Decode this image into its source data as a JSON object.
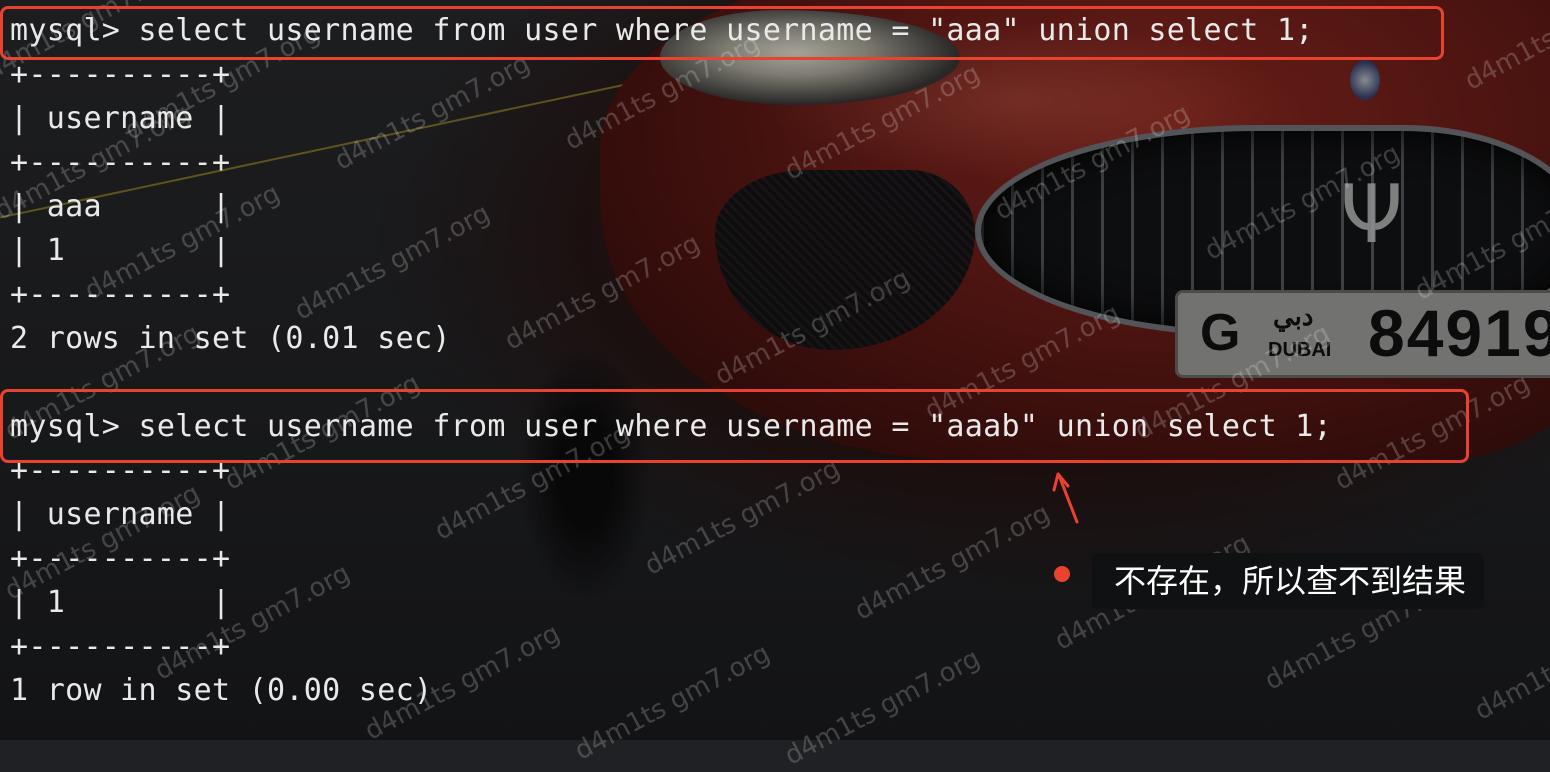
{
  "terminal": {
    "query1": {
      "command": "mysql> select username from user where username = \"aaa\" union select 1;",
      "table_border": "+----------+",
      "header": "| username |",
      "rows": [
        "| aaa      |",
        "| 1        |"
      ],
      "summary": "2 rows in set (0.01 sec)"
    },
    "query2": {
      "command": "mysql> select username from user where username = \"aaab\" union select 1;",
      "table_border": "+----------+",
      "header": "| username |",
      "rows": [
        "| 1        |"
      ],
      "summary": "1 row in set (0.00 sec)"
    }
  },
  "annotation": {
    "note": "不存在，所以查不到结果"
  },
  "watermark": "d4m1ts gm7.org",
  "license_plate": {
    "letter": "G",
    "city": "DUBAI",
    "arabic": "دبي",
    "number": "84919"
  },
  "colors": {
    "highlight": "#e8432e",
    "terminal_text": "#e9e9e9",
    "note_background": "#101112"
  }
}
